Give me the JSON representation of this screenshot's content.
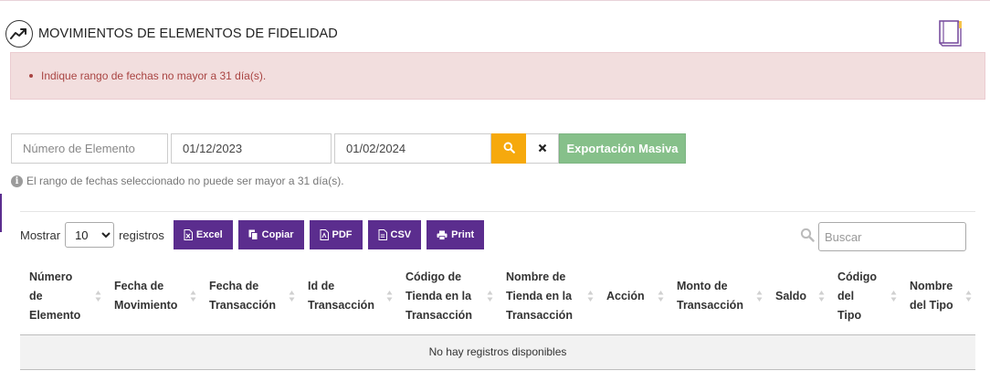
{
  "header": {
    "title": "MOVIMIENTOS DE ELEMENTOS DE FIDELIDAD",
    "icon": "trend-chart-icon",
    "book_icon": "book-icon"
  },
  "alert": {
    "message": "Indique rango de fechas no mayor a 31 día(s)."
  },
  "filters": {
    "element_placeholder": "Número de Elemento",
    "date_from": "01/12/2023",
    "date_to": "01/02/2024",
    "export_label": "Exportación Masiva"
  },
  "hint": {
    "text": "El rango de fechas seleccionado no puede ser mayor a 31 día(s)."
  },
  "table_tools": {
    "show_label": "Mostrar",
    "page_length": "10",
    "records_label": "registros",
    "buttons": [
      "Excel",
      "Copiar",
      "PDF",
      "CSV",
      "Print"
    ],
    "search_placeholder": "Buscar"
  },
  "table": {
    "columns": [
      [
        "Número",
        "de",
        "Elemento"
      ],
      [
        "Fecha de",
        "Movimiento"
      ],
      [
        "Fecha de",
        "Transacción"
      ],
      [
        "Id de",
        "Transacción"
      ],
      [
        "Código de",
        "Tienda en la",
        "Transacción"
      ],
      [
        "Nombre de",
        "Tienda en la",
        "Transacción"
      ],
      [
        "Acción"
      ],
      [
        "Monto de",
        "Transacción"
      ],
      [
        "Saldo"
      ],
      [
        "Código",
        "del",
        "Tipo"
      ],
      [
        "Nombre",
        "del Tipo"
      ]
    ],
    "empty_message": "No hay registros disponibles"
  },
  "colors": {
    "primary": "#5b2d8e",
    "search_button": "#f6a90d",
    "export_button": "#86c08a",
    "alert_bg": "#f2dede",
    "alert_text": "#a94442"
  }
}
